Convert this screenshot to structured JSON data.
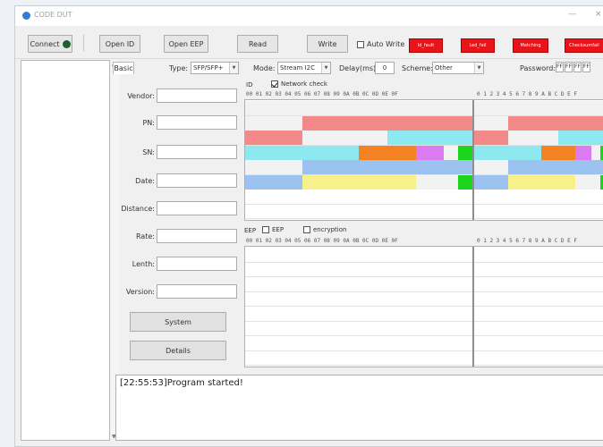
{
  "window": {
    "title": "CODE DUT",
    "minimize": "—",
    "close": "×"
  },
  "toolbar": {
    "connect": "Connect",
    "open_id": "Open ID",
    "open_eep": "Open EEP",
    "read": "Read",
    "write": "Write",
    "auto_write": "Auto Write",
    "red_buttons": [
      "Id_fault",
      "Led_fail",
      "Matching",
      "Checksumfail"
    ]
  },
  "tabs": {
    "basic": "Basic"
  },
  "params": {
    "type_label": "Type:",
    "type_value": "SFP/SFP+",
    "mode_label": "Mode:",
    "mode_value": "Stream I2C",
    "delay_label": "Delay(ms):",
    "delay_value": "0",
    "scheme_label": "Scheme:",
    "scheme_value": "Other",
    "password_label": "Password:",
    "password_values": [
      "FF",
      "FF",
      "FF",
      "FF"
    ]
  },
  "fields": {
    "vendor": "Vendor:",
    "pn": "PN:",
    "sn": "SN:",
    "date": "Date:",
    "distance": "Distance:",
    "rate": "Rate:",
    "lenth": "Lenth:",
    "version": "Version:"
  },
  "buttons": {
    "system": "System",
    "details": "Details"
  },
  "id_section": {
    "label": "ID",
    "network_check": "Network check",
    "network_checked": true
  },
  "eep_section": {
    "label": "EEP",
    "eep_check": "EEP",
    "encryption": "encryption"
  },
  "hex_header": "00 01 02 03 04 05 06 07 08 09 0A 0B 0C 0D 0E 0F",
  "ascii_header": "0 1 2 3 4 5 6 7 8 9 A B C D E F",
  "log": {
    "lines": [
      "[22:55:53]Program started!"
    ]
  },
  "colors": {
    "salmon": "#f28a8a",
    "cyan": "#8ee8f0",
    "orange": "#f58220",
    "violet": "#dc7af0",
    "green": "#1ed51e",
    "blue": "#9cc3f0",
    "yellow": "#f8f08a",
    "gray": "#f2f2f2"
  },
  "id_grid_rows": [
    [
      [
        "gray",
        16
      ]
    ],
    [
      [
        "gray",
        4
      ],
      [
        "salmon",
        12
      ]
    ],
    [
      [
        "salmon",
        4
      ],
      [
        "gray",
        6
      ],
      [
        "cyan",
        6
      ]
    ],
    [
      [
        "cyan",
        8
      ],
      [
        "orange",
        4
      ],
      [
        "violet",
        2
      ],
      [
        "gray",
        1
      ],
      [
        "green",
        1
      ]
    ],
    [
      [
        "gray",
        4
      ],
      [
        "blue",
        12
      ]
    ],
    [
      [
        "blue",
        4
      ],
      [
        "yellow",
        8
      ],
      [
        "gray",
        3
      ],
      [
        "green",
        1
      ]
    ]
  ]
}
